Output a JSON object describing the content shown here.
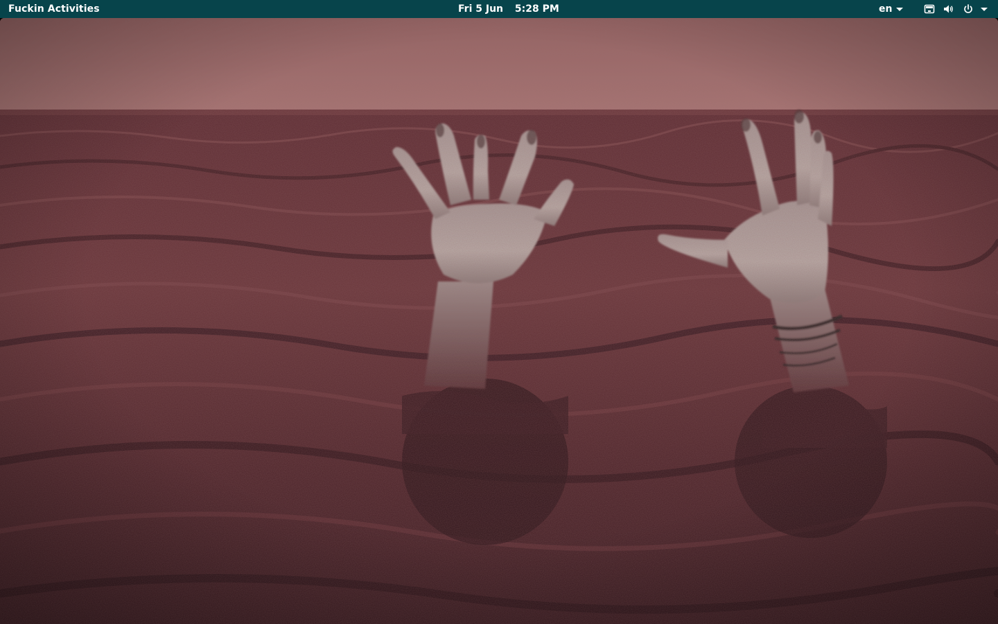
{
  "topbar": {
    "activities_label": "Fuckin Activities",
    "date": "Fri 5 Jun",
    "time": "5:28 PM",
    "language": "en",
    "tray": {
      "icons": [
        "screen-icon",
        "volume-icon",
        "power-icon",
        "system-menu-chevron-icon"
      ]
    }
  },
  "colors": {
    "topbar_bg": "#07444b",
    "sky": "#9c6a68",
    "sea_light": "#6e3a3d",
    "sea_dark": "#3b1c21",
    "skin": "#b7a9a6"
  },
  "wallpaper": {
    "subject": "two-hands-rising-from-sea"
  }
}
